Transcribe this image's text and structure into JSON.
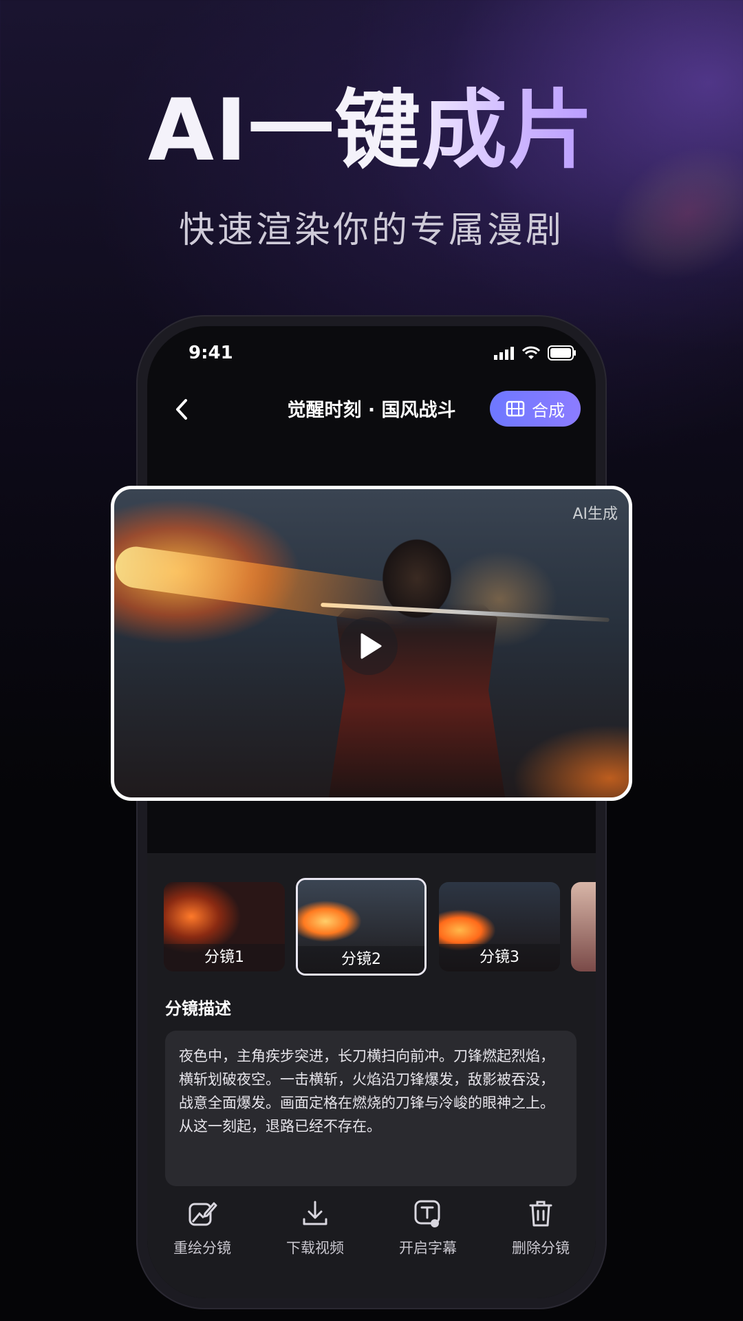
{
  "promo": {
    "headline_part1": "AI一键",
    "headline_part2": "成片",
    "subline": "快速渲染你的专属漫剧"
  },
  "status_bar": {
    "time": "9:41"
  },
  "header": {
    "title": "觉醒时刻 · 国风战斗",
    "compose_label": "合成"
  },
  "hero": {
    "badge": "AI生成"
  },
  "storyboards": [
    {
      "label": "分镜1",
      "selected": false
    },
    {
      "label": "分镜2",
      "selected": true
    },
    {
      "label": "分镜3",
      "selected": false
    }
  ],
  "description": {
    "label": "分镜描述",
    "text": "夜色中，主角疾步突进，长刀横扫向前冲。刀锋燃起烈焰，横斩划破夜空。一击横斩，火焰沿刀锋爆发，敌影被吞没，战意全面爆发。画面定格在燃烧的刀锋与冷峻的眼神之上。从这一刻起，退路已经不存在。"
  },
  "toolbar": {
    "items": [
      {
        "label": "重绘分镜",
        "icon": "redraw-icon"
      },
      {
        "label": "下载视频",
        "icon": "download-icon"
      },
      {
        "label": "开启字幕",
        "icon": "subtitle-icon"
      },
      {
        "label": "删除分镜",
        "icon": "trash-icon"
      }
    ]
  },
  "colors": {
    "accent": "#7c7cff",
    "background": "#050507"
  }
}
